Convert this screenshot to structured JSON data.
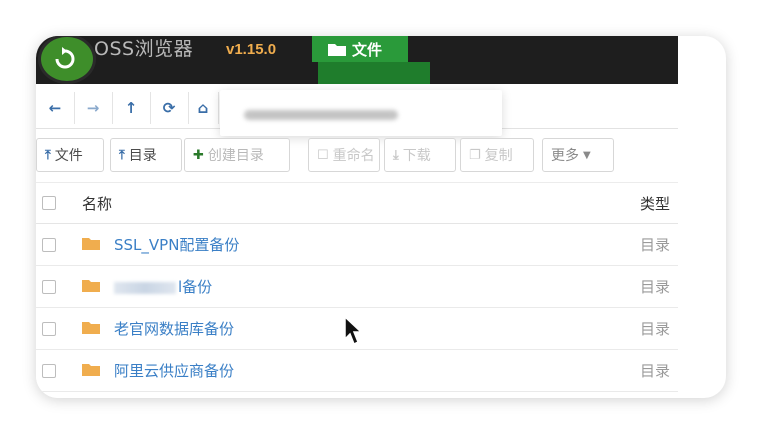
{
  "header": {
    "app_title": "OSS浏览器",
    "version": "v1.15.0",
    "nav_tab_label": "文件",
    "accent_color": "#2a9a3a",
    "version_color": "#f0ad4e"
  },
  "nav_buttons": [
    {
      "icon": "arrow-left-icon",
      "glyph": "←"
    },
    {
      "icon": "arrow-right-icon",
      "glyph": "→"
    },
    {
      "icon": "arrow-up-icon",
      "glyph": "↑"
    },
    {
      "icon": "refresh-icon",
      "glyph": "⟳"
    },
    {
      "icon": "home-icon",
      "glyph": "⌂"
    }
  ],
  "toolbar": {
    "upload_file": "文件",
    "upload_folder": "目录",
    "create_folder": "创建目录",
    "rename": "重命名",
    "download": "下载",
    "copy": "复制",
    "more": "更多"
  },
  "table": {
    "col_name": "名称",
    "col_type": "类型",
    "rows": [
      {
        "name": "SSL_VPN配置备份",
        "type": "目录"
      },
      {
        "name": "l备份",
        "type": "目录"
      },
      {
        "name": "老官网数据库备份",
        "type": "目录"
      },
      {
        "name": "阿里云供应商备份",
        "type": "目录"
      }
    ]
  }
}
